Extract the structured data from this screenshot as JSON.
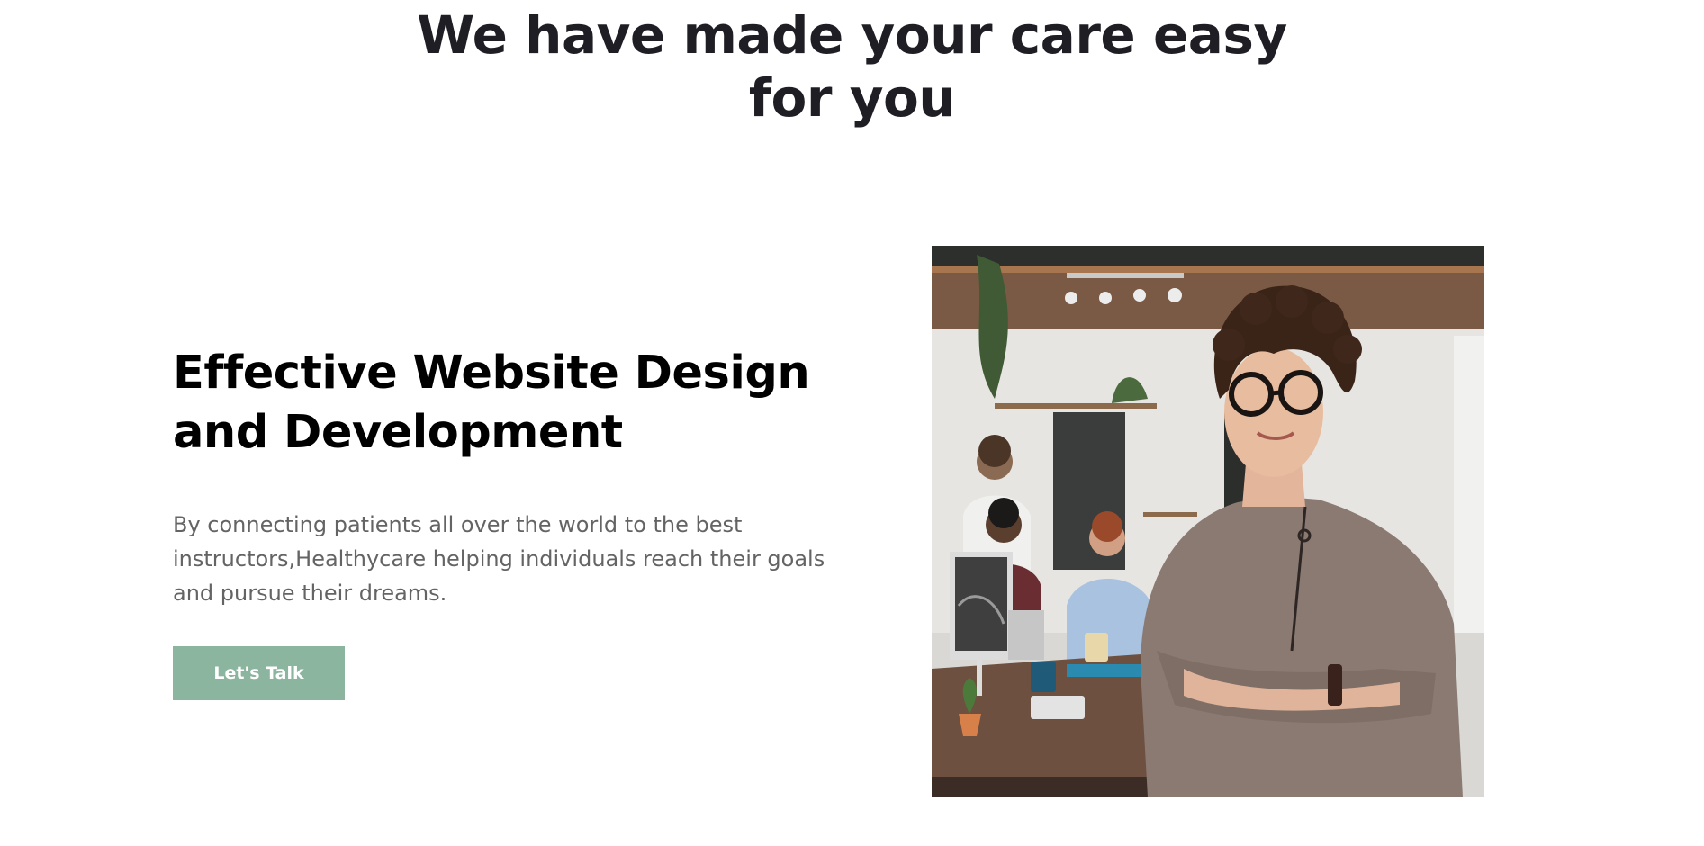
{
  "section": {
    "heading_line1": "We have made your care easy",
    "heading_line2": "for you"
  },
  "feature": {
    "title_line1": "Effective Website Design",
    "title_line2": "and Development",
    "description_line1": "By connecting patients all over the world to the best",
    "description_line2": "instructors,Healthycare helping individuals reach their goals",
    "description_line3": "and pursue their dreams.",
    "cta_label": "Let's Talk"
  },
  "photo": {
    "alt": "Smiling woman with glasses standing with arms crossed in an office, colleagues working at a table behind her"
  },
  "colors": {
    "accent": "#8bb59e",
    "heading": "#1e1e24",
    "body_text": "#646464"
  }
}
